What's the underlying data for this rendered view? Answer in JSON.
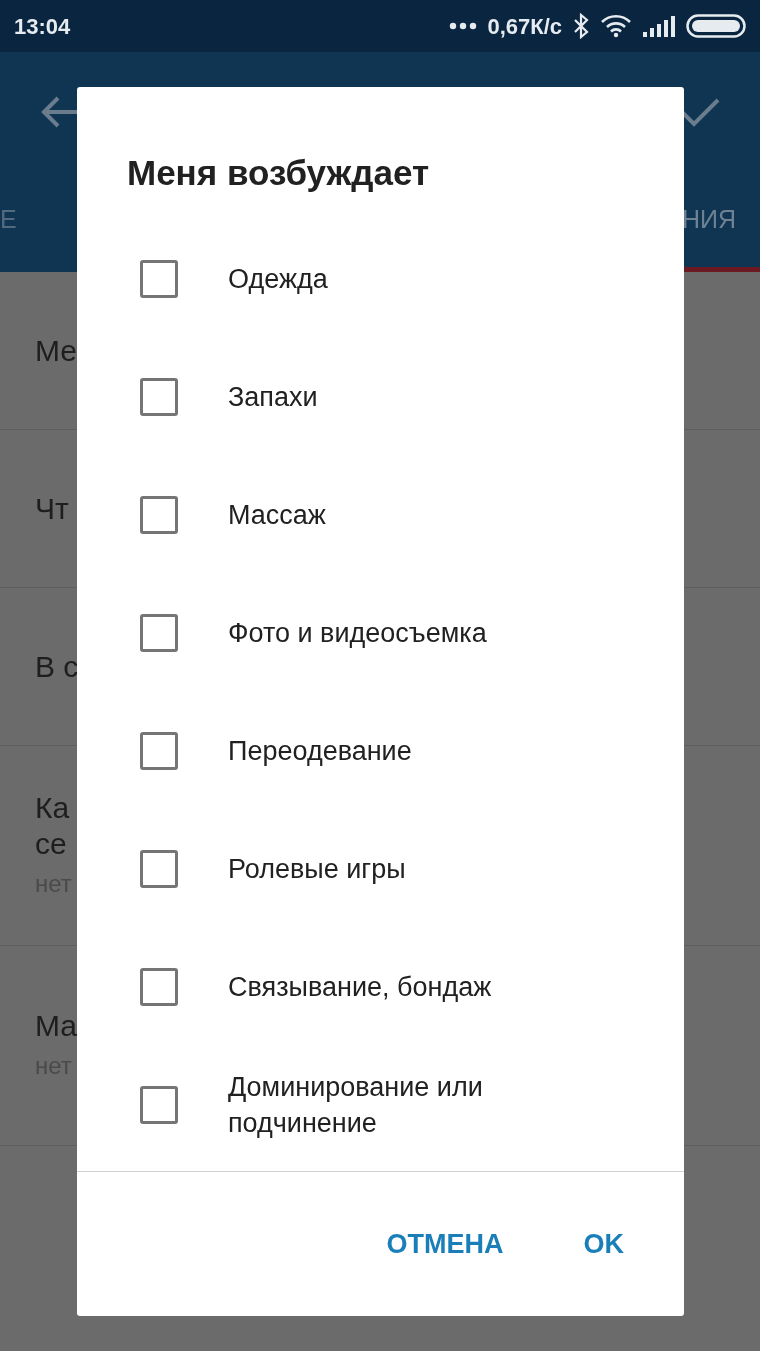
{
  "status_bar": {
    "time": "13:04",
    "network_speed": "0,67К/с"
  },
  "app_bar": {
    "tabs": [
      {
        "label": "Е",
        "selected": false
      },
      {
        "label": "НИЯ",
        "selected": true
      }
    ]
  },
  "background_list": [
    {
      "title": "Ме"
    },
    {
      "title": "Чт"
    },
    {
      "title": "В с"
    },
    {
      "title": "Ка\nсе",
      "subtitle": "нет"
    },
    {
      "title": "Ма",
      "subtitle": "нет"
    }
  ],
  "dialog": {
    "title": "Меня возбуждает",
    "options": [
      {
        "label": "Одежда",
        "checked": false
      },
      {
        "label": "Запахи",
        "checked": false
      },
      {
        "label": "Массаж",
        "checked": false
      },
      {
        "label": "Фото и видеосъемка",
        "checked": false
      },
      {
        "label": "Переодевание",
        "checked": false
      },
      {
        "label": "Ролевые игры",
        "checked": false
      },
      {
        "label": "Связывание, бондаж",
        "checked": false
      },
      {
        "label": "Доминирование или\nподчинение",
        "checked": false
      }
    ],
    "buttons": [
      "ОТМЕНА",
      "OK"
    ]
  }
}
